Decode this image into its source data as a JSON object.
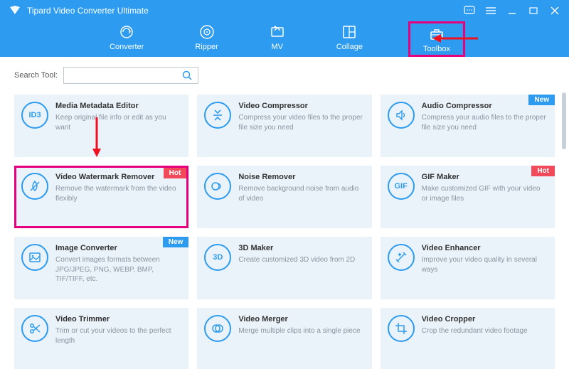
{
  "app": {
    "title": "Tipard Video Converter Ultimate"
  },
  "tabs": [
    {
      "label": "Converter"
    },
    {
      "label": "Ripper"
    },
    {
      "label": "MV"
    },
    {
      "label": "Collage"
    },
    {
      "label": "Toolbox"
    }
  ],
  "search": {
    "label": "Search Tool:",
    "placeholder": ""
  },
  "badges": {
    "hot": "Hot",
    "new": "New"
  },
  "tools": [
    {
      "title": "Media Metadata Editor",
      "desc": "Keep original file info or edit as you want",
      "icon": "ID3",
      "badge": null
    },
    {
      "title": "Video Compressor",
      "desc": "Compress your video files to the proper file size you need",
      "icon": "compress",
      "badge": null
    },
    {
      "title": "Audio Compressor",
      "desc": "Compress your audio files to the proper file size you need",
      "icon": "audio-compress",
      "badge": "new"
    },
    {
      "title": "Video Watermark Remover",
      "desc": "Remove the watermark from the video flexibly",
      "icon": "watermark",
      "badge": "hot",
      "highlight": true
    },
    {
      "title": "Noise Remover",
      "desc": "Remove background noise from audio of video",
      "icon": "noise",
      "badge": null
    },
    {
      "title": "GIF Maker",
      "desc": "Make customized GIF with your video or image files",
      "icon": "GIF",
      "badge": "hot"
    },
    {
      "title": "Image Converter",
      "desc": "Convert images formats between JPG/JPEG, PNG, WEBP, BMP, TIF/TIFF, etc.",
      "icon": "image",
      "badge": "new"
    },
    {
      "title": "3D Maker",
      "desc": "Create customized 3D video from 2D",
      "icon": "3D",
      "badge": null
    },
    {
      "title": "Video Enhancer",
      "desc": "Improve your video quality in several ways",
      "icon": "enhance",
      "badge": null
    },
    {
      "title": "Video Trimmer",
      "desc": "Trim or cut your videos to the perfect length",
      "icon": "trim",
      "badge": null
    },
    {
      "title": "Video Merger",
      "desc": "Merge multiple clips into a single piece",
      "icon": "merge",
      "badge": null
    },
    {
      "title": "Video Cropper",
      "desc": "Crop the redundant video footage",
      "icon": "crop",
      "badge": null
    }
  ]
}
